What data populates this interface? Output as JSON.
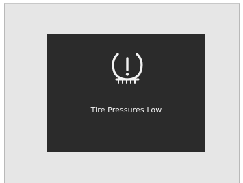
{
  "warning": {
    "icon": "tpms-warning-icon",
    "message": "Tire Pressures Low"
  },
  "colors": {
    "frame_background": "#e6e6e6",
    "screen_background": "#2b2b2b",
    "text": "#f2f2f2",
    "icon": "#f2f2f2"
  }
}
